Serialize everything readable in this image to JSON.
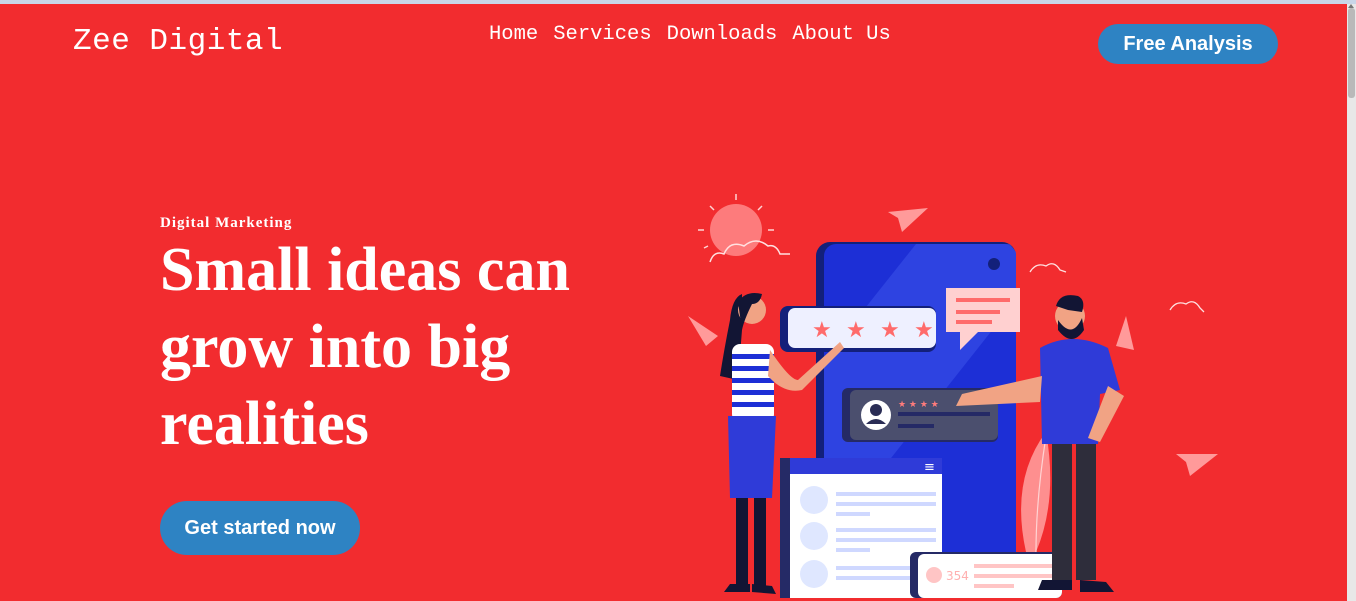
{
  "brand": {
    "name": "Zee Digital"
  },
  "nav": {
    "items": [
      {
        "label": "Home"
      },
      {
        "label": "Services"
      },
      {
        "label": "Downloads"
      },
      {
        "label": "About Us"
      }
    ]
  },
  "header": {
    "cta_label": "Free Analysis"
  },
  "hero": {
    "eyebrow": "Digital Marketing",
    "headline": "Small ideas can grow into big realities",
    "cta_label": "Get started now"
  },
  "illustration": {
    "review_count": "354",
    "rating_stars": "★ ★ ★ ★"
  },
  "colors": {
    "background": "#f22c2f",
    "button": "#2e83c3",
    "phone": "#1d2fd6",
    "text": "#ffffff"
  }
}
